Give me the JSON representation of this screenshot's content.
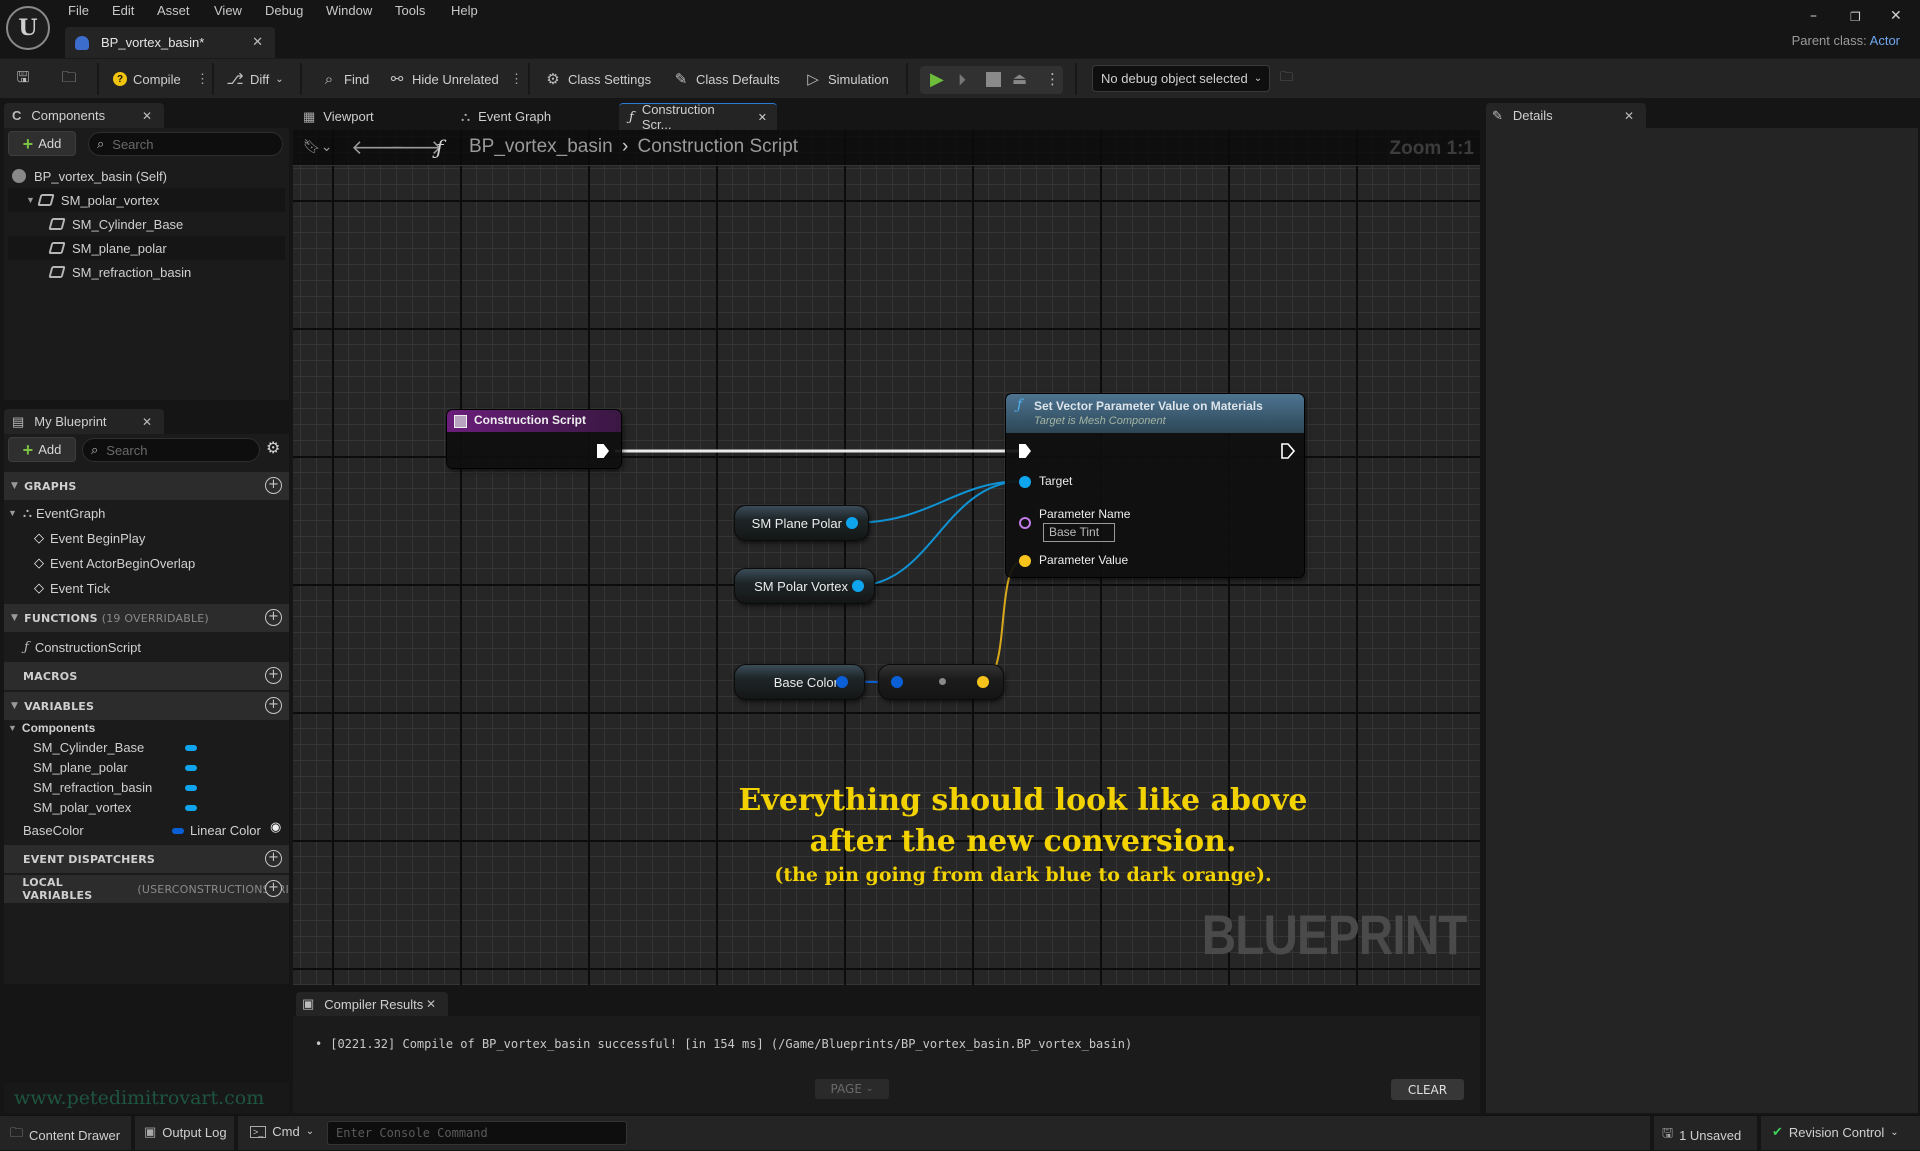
{
  "app": {
    "logo": "unreal-engine-logo",
    "menu": [
      "File",
      "Edit",
      "Asset",
      "View",
      "Debug",
      "Window",
      "Tools",
      "Help"
    ],
    "document_tab": "BP_vortex_basin*",
    "parent_class_label": "Parent class:",
    "parent_class_value": "Actor",
    "window_controls": [
      "minimize",
      "restore",
      "close"
    ]
  },
  "toolbar": {
    "compile": "Compile",
    "diff": "Diff",
    "find": "Find",
    "hide_unrelated": "Hide Unrelated",
    "class_settings": "Class Settings",
    "class_defaults": "Class Defaults",
    "simulation": "Simulation",
    "debug_object": "No debug object selected"
  },
  "components_panel": {
    "title": "Components",
    "add_label": "Add",
    "search_placeholder": "Search",
    "tree": [
      {
        "label": "BP_vortex_basin (Self)",
        "level": 0,
        "icon": "actor-icon"
      },
      {
        "label": "SM_polar_vortex",
        "level": 1,
        "icon": "static-mesh-icon",
        "expanded": true
      },
      {
        "label": "SM_Cylinder_Base",
        "level": 2,
        "icon": "static-mesh-icon"
      },
      {
        "label": "SM_plane_polar",
        "level": 2,
        "icon": "static-mesh-icon"
      },
      {
        "label": "SM_refraction_basin",
        "level": 2,
        "icon": "static-mesh-icon"
      }
    ]
  },
  "my_blueprint": {
    "title": "My Blueprint",
    "add_label": "Add",
    "search_placeholder": "Search",
    "graphs_label": "GRAPHS",
    "event_graph": "EventGraph",
    "events": [
      "Event BeginPlay",
      "Event ActorBeginOverlap",
      "Event Tick"
    ],
    "functions_label": "FUNCTIONS",
    "functions_note": "(19 OVERRIDABLE)",
    "functions": [
      "ConstructionScript"
    ],
    "macros_label": "MACROS",
    "variables_label": "VARIABLES",
    "components_group": "Components",
    "component_vars": [
      "SM_Cylinder_Base",
      "SM_plane_polar",
      "SM_refraction_basin",
      "SM_polar_vortex"
    ],
    "base_color_var": "BaseColor",
    "base_color_type": "Linear Color",
    "event_dispatchers_label": "EVENT DISPATCHERS",
    "local_variables_label": "LOCAL VARIABLES",
    "local_variables_note": "(USERCONSTRUCTIONSCRI"
  },
  "graph": {
    "tabs": [
      "Viewport",
      "Event Graph",
      "Construction Scr..."
    ],
    "active_tab": 2,
    "breadcrumb": [
      "BP_vortex_basin",
      "Construction Script"
    ],
    "zoom": "Zoom 1:1",
    "watermark": "BLUEPRINT",
    "nodes": {
      "construction_script": "Construction Script",
      "set_vector_title": "Set Vector Parameter Value on Materials",
      "set_vector_subtitle": "Target is Mesh Component",
      "pin_target": "Target",
      "pin_param_name": "Parameter Name",
      "param_name_value": "Base Tint",
      "pin_param_value": "Parameter Value",
      "var_plane": "SM Plane Polar",
      "var_vortex": "SM Polar Vortex",
      "var_base_color": "Base Color"
    },
    "comment": {
      "line1": "Everything should look like above",
      "line2": "after the new conversion.",
      "line3": "(the pin going from dark blue to dark orange)."
    },
    "colors": {
      "object_pin": "#0fa5ee",
      "linear_color_pin": "#0a5fd6",
      "vector_pin": "#f5c31b",
      "name_pin": "#c27ae8",
      "exec": "#ffffff",
      "comment_text": "#f2d200"
    }
  },
  "details_panel": {
    "title": "Details"
  },
  "compiler_results": {
    "title": "Compiler Results",
    "messages": [
      "[0221.32] Compile of BP_vortex_basin successful! [in 154 ms] (/Game/Blueprints/BP_vortex_basin.BP_vortex_basin)"
    ],
    "page_label": "PAGE",
    "clear_label": "CLEAR"
  },
  "website": "www.petedimitrovart.com",
  "status_bar": {
    "content_drawer": "Content Drawer",
    "output_log": "Output Log",
    "cmd": "Cmd",
    "console_placeholder": "Enter Console Command",
    "unsaved": "1 Unsaved",
    "revision_control": "Revision Control"
  }
}
